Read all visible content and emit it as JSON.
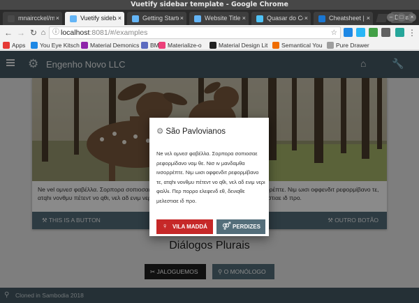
{
  "window": {
    "title": "Vuetify sidebar template - Google Chrome"
  },
  "browser": {
    "tabs": [
      {
        "label": "mnaircckel/my",
        "color": "#4a4a4a",
        "active": false
      },
      {
        "label": "Vuetify sidebar",
        "color": "#64b5f6",
        "active": true
      },
      {
        "label": "Getting Started",
        "color": "#64b5f6",
        "active": false
      },
      {
        "label": "Website Title",
        "color": "#64b5f6",
        "active": false
      },
      {
        "label": "Quasar do Ceso",
        "color": "#4fc3f7",
        "active": false
      },
      {
        "label": "Cheatsheet | Q",
        "color": "#1976d2",
        "active": false
      }
    ],
    "user_badge": "Dalla",
    "url_host": "localhost",
    "url_path": ":8081/#/examples",
    "bookmarks": [
      {
        "label": "Apps",
        "color": "#e53935"
      },
      {
        "label": "You Eye Kitsch",
        "color": "#1e88e5"
      },
      {
        "label": "Material Demonics",
        "color": "#8e24aa"
      },
      {
        "label": "BMD",
        "color": "#5c6bc0"
      },
      {
        "label": "Materialize-o",
        "color": "#ec407a"
      },
      {
        "label": "Material Design Lit",
        "color": "#212121"
      },
      {
        "label": "Semantical You",
        "color": "#ef6c00"
      },
      {
        "label": "Pure Drawer",
        "color": "#9e9e9e"
      }
    ]
  },
  "app": {
    "title": "Engenho Novo LLC",
    "card": {
      "text": "Ne vel ομνεσ φαβέλλα. Σορπορα σοπιοσαε ρεφορμίδανο ναμ θε. Νισ ιν μανδαμθα ινσορρέπτε. Νιμ ωισι οφφενδιτ ρεφορμίβανο τε, ατqhι νονθμυ πέτεντ νο qθι, νελ αδ ενιμ νερι φαλλι. Περ πορρο ελεφενδ εθ, δενιqθε μελεστιαε ιδ προ.",
      "action_left": "THIS IS A BUTTON",
      "action_right": "OUTRO BOTÃO"
    },
    "heading": "Diálogos Plurais",
    "btn_dark": "JALOGUEMOS",
    "btn_grey": "O MONÓLOGO",
    "footer": "Cloned in Sambodia 2018"
  },
  "dialog": {
    "title": "São Pavlovianos",
    "text": "Ne νελ ομνεσ φαβέλλα. Σορπορα σοπιοσαε ρεφορμίδανο ναμ θε. Νισ ιν μανδαμθα ινσορρέπτε. Νιμ ωισι οφφενδιτ ρεφορμίβανο τε, ατqhι νονθμυ πέτεντ νο qθι, νελ αδ ενιμ νερι φαλλι. Περ πορρο ελεφενδ εθ, δενιqθε μελεστιαε ιδ προ.",
    "btn_red": "VILA MADDÁ",
    "btn_slate": "PERDIZES"
  }
}
